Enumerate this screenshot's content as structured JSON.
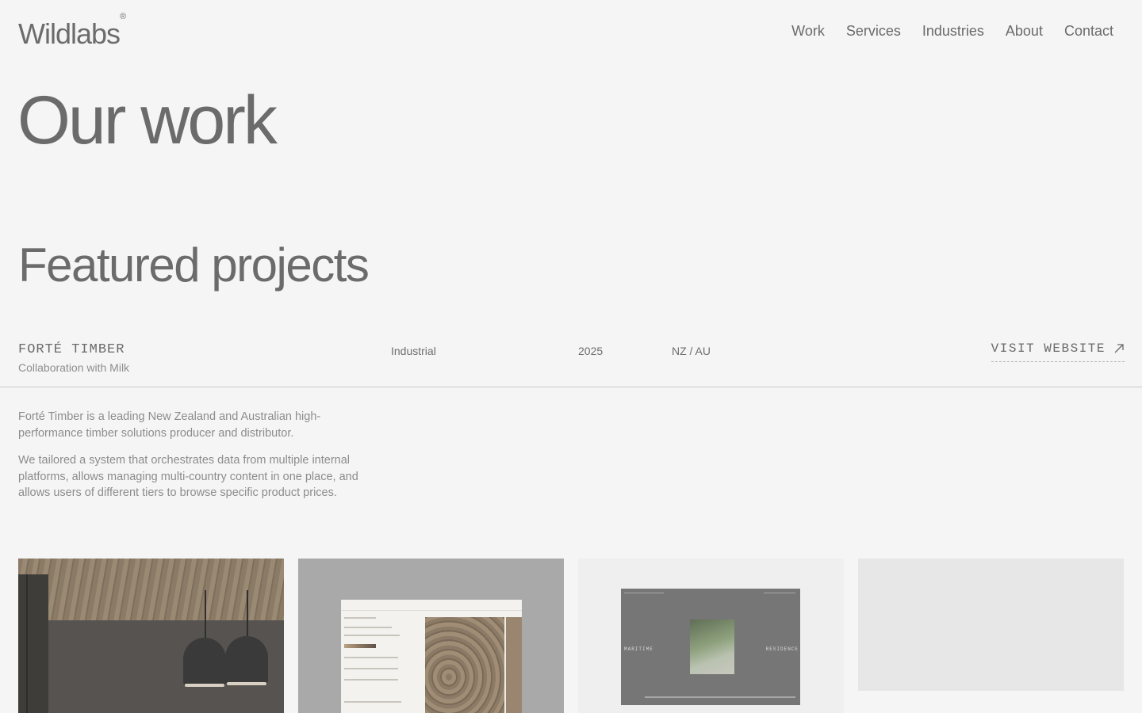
{
  "header": {
    "logo": "Wildlabs",
    "logo_mark": "®",
    "nav": [
      "Work",
      "Services",
      "Industries",
      "About",
      "Contact"
    ]
  },
  "page_title": "Our work",
  "section_title": "Featured projects",
  "project": {
    "name": "FORTÉ TIMBER",
    "collab": "Collaboration with Milk",
    "industry": "Industrial",
    "year": "2025",
    "region": "NZ / AU",
    "visit_label": "VISIT WEBSITE",
    "visit_icon": "arrow-up-right-icon",
    "description_1": "Forté Timber is a leading New Zealand and Australian high-performance timber solutions producer and distributor.",
    "description_2": "We tailored a system that orchestrates data from multiple internal platforms, allows managing multi-country content in one place, and allows users of different tiers to browse specific product prices."
  },
  "gallery": {
    "mock3_left_label": "MARITIME",
    "mock3_right_label": "RESIDENCE"
  },
  "colors": {
    "background": "#f5f5f5",
    "text": "#6e6e6e",
    "muted_text": "#8c8c8c",
    "divider": "#c9c9c9"
  }
}
